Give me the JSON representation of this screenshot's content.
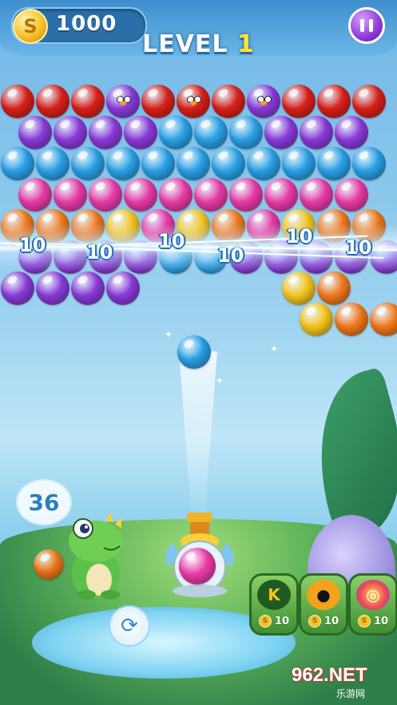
{
  "hud": {
    "coin_icon_glyph": "S",
    "coins": "1000",
    "level_label": "LEVEL",
    "level_number": "1",
    "pause_icon": "pause-icon"
  },
  "colors": {
    "red": "#d9201a",
    "purple": "#8a3ad8",
    "blue": "#2aa0e6",
    "pink": "#e83aa6",
    "orange": "#f0781c",
    "yellow": "#f4c51e"
  },
  "bubble_grid": {
    "rows": [
      [
        "red",
        "red",
        "red",
        "purple-creature",
        "red",
        "red-creature",
        "red",
        "purple-creature",
        "red",
        "red",
        "red"
      ],
      [
        "purple",
        "purple",
        "purple",
        "purple",
        "blue",
        "blue",
        "blue",
        "purple",
        "purple",
        "purple"
      ],
      [
        "blue",
        "blue",
        "blue",
        "blue",
        "blue",
        "blue",
        "blue",
        "blue",
        "blue",
        "blue",
        "blue"
      ],
      [
        "pink",
        "pink",
        "pink",
        "pink",
        "pink",
        "pink",
        "pink",
        "pink",
        "pink",
        "pink"
      ],
      [
        "orange",
        "orange",
        "orange",
        "yellow",
        "pink",
        "yellow",
        "orange",
        "pink",
        "yellow",
        "orange",
        "orange"
      ],
      [
        "purple",
        "purple",
        "purple",
        "purple",
        "blue",
        "blue",
        "purple",
        "purple",
        "purple",
        "purple",
        "purple"
      ],
      [
        "purple",
        "purple",
        "purple",
        "purple",
        "",
        "",
        "",
        "",
        "yellow",
        "orange"
      ],
      [
        "",
        "",
        "",
        "",
        "",
        "",
        "",
        "",
        "yellow",
        "orange",
        "orange"
      ]
    ]
  },
  "score_popups": [
    "10",
    "10",
    "10",
    "10",
    "10",
    "10"
  ],
  "current_bubble": "blue",
  "launcher_bubble": "pink",
  "moves_left": "36",
  "next_bubble": "orange",
  "swap_icon": "swap-icon",
  "boosters": [
    {
      "icon": "k-block-icon",
      "glyph": "K",
      "cost": "10",
      "coin_glyph": "S"
    },
    {
      "icon": "bomb-icon",
      "glyph": "●",
      "cost": "10",
      "coin_glyph": "S"
    },
    {
      "icon": "rainbow-ball-icon",
      "glyph": "◎",
      "cost": "10",
      "coin_glyph": "S"
    }
  ],
  "watermark": {
    "main": "962.NET",
    "sub": "乐游网"
  }
}
